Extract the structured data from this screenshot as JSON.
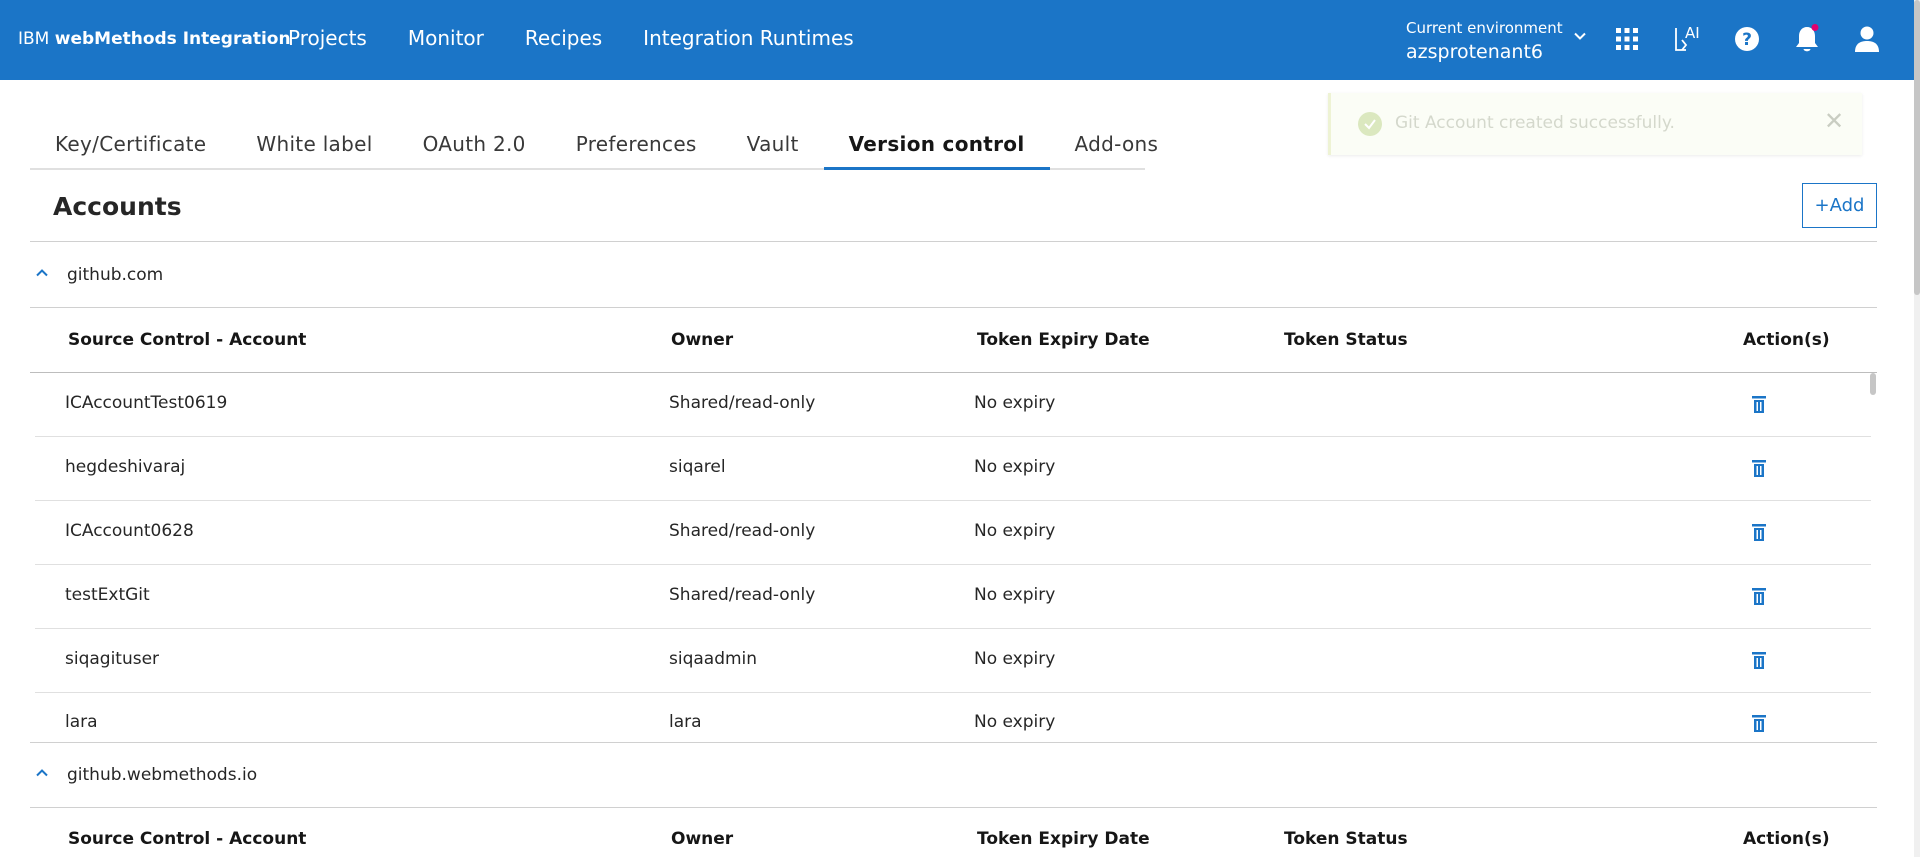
{
  "topbar": {
    "brand_prefix": "IBM",
    "brand_name": "webMethods Integration",
    "nav": [
      "Projects",
      "Monitor",
      "Recipes",
      "Integration Runtimes"
    ],
    "env_label": "Current environment",
    "env_name": "azsprotenant6",
    "ai_label": "AI",
    "icons": [
      "apps-grid-icon",
      "ai-assistant-icon",
      "help-icon",
      "notifications-icon",
      "user-avatar-icon"
    ]
  },
  "tabs": [
    {
      "label": "Key/Certificate"
    },
    {
      "label": "White label"
    },
    {
      "label": "OAuth 2.0"
    },
    {
      "label": "Preferences"
    },
    {
      "label": "Vault"
    },
    {
      "label": "Version control"
    },
    {
      "label": "Add-ons"
    }
  ],
  "active_tab": "Version control",
  "toast": {
    "message": "Git Account created successfully."
  },
  "accounts": {
    "title": "Accounts",
    "add_label": "+Add",
    "columns": [
      "Source Control - Account",
      "Owner",
      "Token Expiry Date",
      "Token Status",
      "Action(s)"
    ],
    "groups": [
      {
        "name": "github.com",
        "rows": [
          {
            "account": "ICAccountTest0619",
            "owner": "Shared/read-only",
            "expiry": "No expiry",
            "status": ""
          },
          {
            "account": "hegdeshivaraj",
            "owner": "siqarel",
            "expiry": "No expiry",
            "status": ""
          },
          {
            "account": "ICAccount0628",
            "owner": "Shared/read-only",
            "expiry": "No expiry",
            "status": ""
          },
          {
            "account": "testExtGit",
            "owner": "Shared/read-only",
            "expiry": "No expiry",
            "status": ""
          },
          {
            "account": "siqagituser",
            "owner": "siqaadmin",
            "expiry": "No expiry",
            "status": ""
          },
          {
            "account": "lara",
            "owner": "lara",
            "expiry": "No expiry",
            "status": ""
          }
        ]
      },
      {
        "name": "github.webmethods.io",
        "rows": []
      }
    ]
  },
  "colors": {
    "topbar": "#1b75c7",
    "accent": "#1b75c7",
    "notification_dot": "#e0006e"
  }
}
